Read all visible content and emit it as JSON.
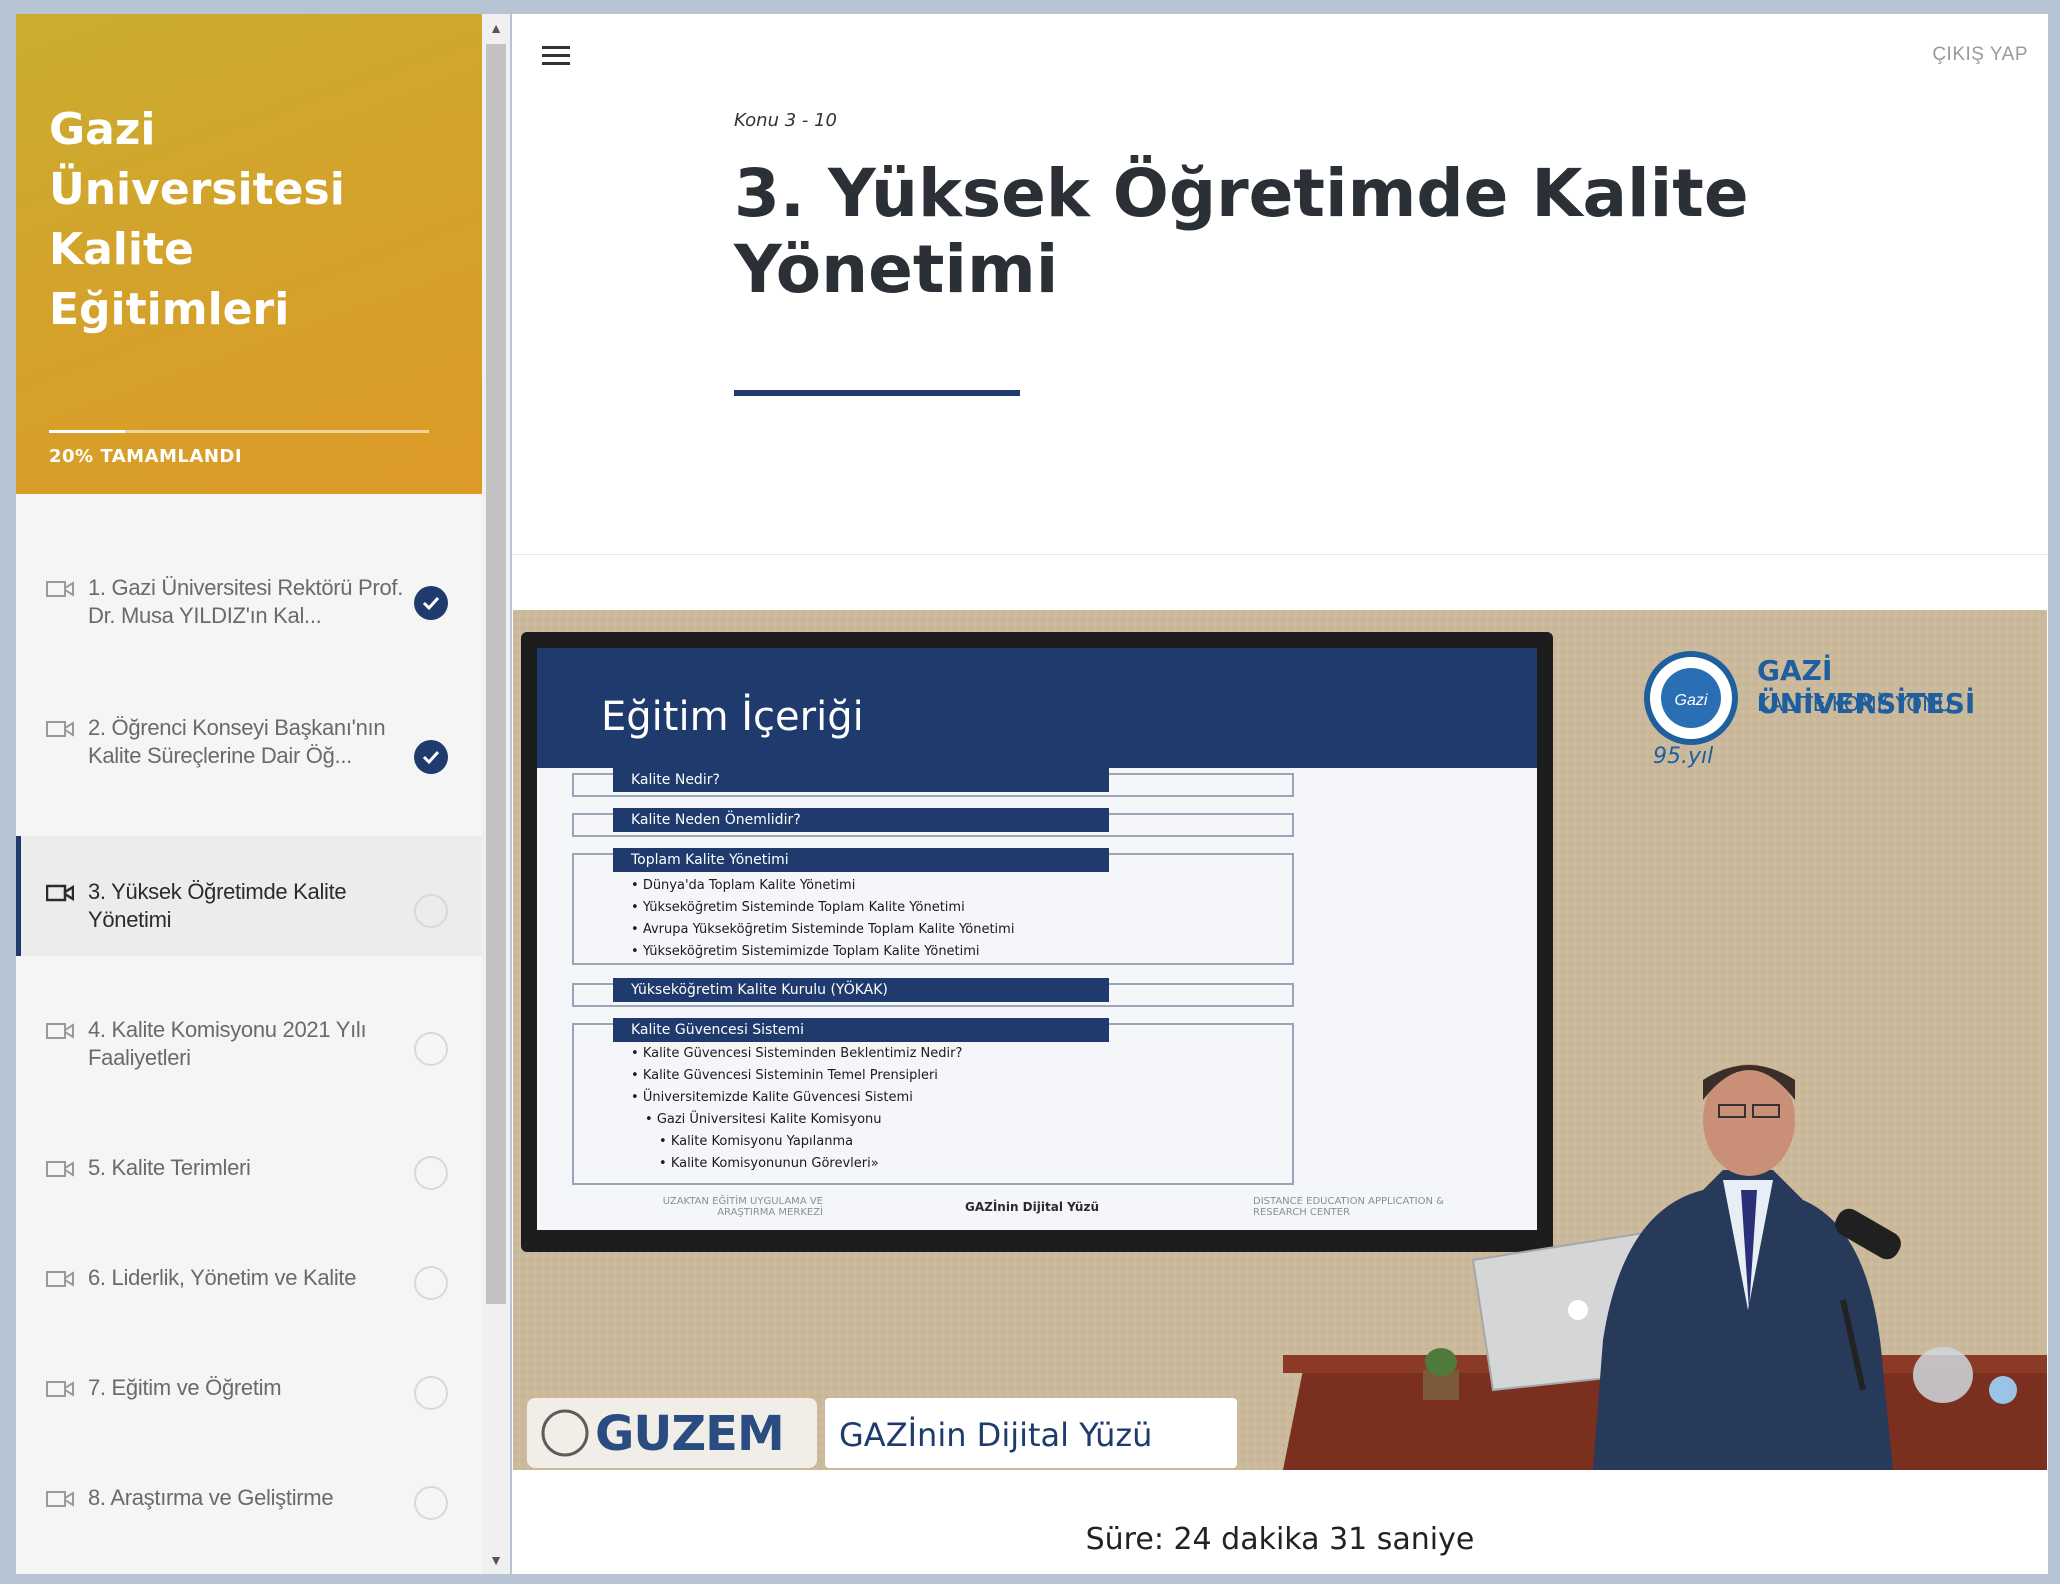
{
  "course": {
    "title": "Gazi Üniversitesi Kalite Eğitimleri",
    "progress_percent": 20,
    "progress_label": "20% TAMAMLANDI"
  },
  "lessons": [
    {
      "label": "1. Gazi Üniversitesi Rektörü Prof. Dr. Musa YILDIZ'ın Kal...",
      "status": "completed"
    },
    {
      "label": "2. Öğrenci Konseyi Başkanı'nın Kalite Süreçlerine Dair Öğ...",
      "status": "completed"
    },
    {
      "label": "3. Yüksek Öğretimde Kalite Yönetimi",
      "status": "current"
    },
    {
      "label": "4. Kalite Komisyonu 2021 Yılı Faaliyetleri",
      "status": "not-started"
    },
    {
      "label": "5. Kalite Terimleri",
      "status": "not-started"
    },
    {
      "label": "6. Liderlik, Yönetim ve Kalite",
      "status": "not-started"
    },
    {
      "label": "7. Eğitim ve Öğretim",
      "status": "not-started"
    },
    {
      "label": "8. Araştırma ve Geliştirme",
      "status": "not-started"
    }
  ],
  "header": {
    "menu_icon": "hamburger-menu-icon",
    "logout_label": "ÇIKIŞ YAP"
  },
  "content": {
    "breadcrumb": "Konu 3 - 10",
    "title": "3. Yüksek Öğretimde Kalite Yönetimi",
    "duration": "Süre: 24 dakika 31 saniye"
  },
  "video": {
    "slide_title": "Eğitim İçeriği",
    "slide_sections": [
      {
        "heading": "Kalite Nedir?",
        "items": []
      },
      {
        "heading": "Kalite Neden Önemlidir?",
        "items": []
      },
      {
        "heading": "Toplam Kalite Yönetimi",
        "items": [
          "Dünya'da Toplam Kalite Yönetimi",
          "Yükseköğretim Sisteminde Toplam Kalite Yönetimi",
          "Avrupa Yükseköğretim Sisteminde Toplam Kalite Yönetimi",
          "Yükseköğretim Sistemimizde Toplam Kalite Yönetimi"
        ]
      },
      {
        "heading": "Yükseköğretim Kalite Kurulu (YÖKAK)",
        "items": []
      },
      {
        "heading": "Kalite Güvencesi Sistemi",
        "items": [
          "Kalite Güvencesi Sisteminden Beklentimiz Nedir?",
          "Kalite Güvencesi Sisteminin Temel Prensipleri",
          "Üniversitemizde Kalite Güvencesi Sistemi",
          "Gazi Üniversitesi Kalite Komisyonu",
          "Kalite Komisyonu Yapılanma",
          "Kalite Komisyonunun Görevleri»"
        ]
      }
    ],
    "slide_footer_left": "UZAKTAN EĞİTİM UYGULAMA VE ARAŞTIRMA MERKEZİ",
    "slide_footer_center": "GAZİnin Dijital Yüzü",
    "slide_footer_right": "DISTANCE EDUCATION APPLICATION & RESEARCH CENTER",
    "university_name": "GAZİ ÜNİVERSİTESİ",
    "university_sub": "KALİTE KOMİSYONU",
    "anniversary": "95.yıl",
    "brand_left": "GUZEM",
    "brand_right": "GAZİnin Dijital Yüzü"
  },
  "colors": {
    "accent": "#1f3b6e",
    "header_gold": "#d5a12a"
  }
}
